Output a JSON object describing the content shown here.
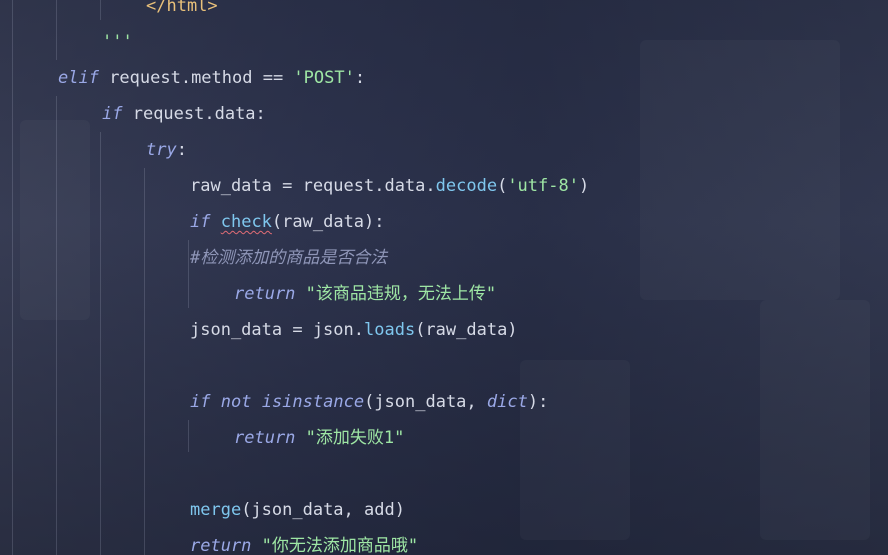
{
  "code_lines": [
    {
      "indent": 146,
      "tokens": [
        {
          "t": "</html>",
          "c": "tag"
        }
      ]
    },
    {
      "indent": 102,
      "tokens": [
        {
          "t": "'''",
          "c": "str"
        }
      ]
    },
    {
      "indent": 58,
      "tokens": [
        {
          "t": "elif",
          "c": "kw"
        },
        {
          "t": " request.method == ",
          "c": "plain"
        },
        {
          "t": "'POST'",
          "c": "str"
        },
        {
          "t": ":",
          "c": "plain"
        }
      ]
    },
    {
      "indent": 102,
      "tokens": [
        {
          "t": "if",
          "c": "kw"
        },
        {
          "t": " request.data:",
          "c": "plain"
        }
      ]
    },
    {
      "indent": 146,
      "tokens": [
        {
          "t": "try",
          "c": "kw"
        },
        {
          "t": ":",
          "c": "plain"
        }
      ]
    },
    {
      "indent": 190,
      "tokens": [
        {
          "t": "raw_data = request.data.",
          "c": "plain"
        },
        {
          "t": "decode",
          "c": "fn"
        },
        {
          "t": "(",
          "c": "plain"
        },
        {
          "t": "'utf-8'",
          "c": "str"
        },
        {
          "t": ")",
          "c": "plain"
        }
      ]
    },
    {
      "indent": 190,
      "tokens": [
        {
          "t": "if",
          "c": "kw"
        },
        {
          "t": " ",
          "c": "plain"
        },
        {
          "t": "check",
          "c": "fn squiggle"
        },
        {
          "t": "(raw_data):",
          "c": "plain"
        }
      ]
    },
    {
      "indent": 190,
      "tokens": [
        {
          "t": "#检测添加的商品是否合法",
          "c": "cm"
        }
      ]
    },
    {
      "indent": 234,
      "tokens": [
        {
          "t": "return",
          "c": "kw"
        },
        {
          "t": " ",
          "c": "plain"
        },
        {
          "t": "\"该商品违规，无法上传\"",
          "c": "str"
        }
      ]
    },
    {
      "indent": 190,
      "tokens": [
        {
          "t": "json_data = json.",
          "c": "plain"
        },
        {
          "t": "loads",
          "c": "fn"
        },
        {
          "t": "(raw_data)",
          "c": "plain"
        }
      ]
    },
    {
      "indent": 190,
      "tokens": []
    },
    {
      "indent": 190,
      "tokens": [
        {
          "t": "if",
          "c": "kw"
        },
        {
          "t": " ",
          "c": "plain"
        },
        {
          "t": "not",
          "c": "kw"
        },
        {
          "t": " ",
          "c": "plain"
        },
        {
          "t": "isinstance",
          "c": "kw"
        },
        {
          "t": "(json_data, ",
          "c": "plain"
        },
        {
          "t": "dict",
          "c": "kw"
        },
        {
          "t": "):",
          "c": "plain"
        }
      ]
    },
    {
      "indent": 234,
      "tokens": [
        {
          "t": "return",
          "c": "kw"
        },
        {
          "t": " ",
          "c": "plain"
        },
        {
          "t": "\"添加失败1\"",
          "c": "str"
        }
      ]
    },
    {
      "indent": 190,
      "tokens": []
    },
    {
      "indent": 190,
      "tokens": [
        {
          "t": "merge",
          "c": "fn"
        },
        {
          "t": "(json_data, add)",
          "c": "plain"
        }
      ]
    },
    {
      "indent": 190,
      "tokens": [
        {
          "t": "return",
          "c": "kw"
        },
        {
          "t": " ",
          "c": "plain"
        },
        {
          "t": "\"你无法添加商品哦\"",
          "c": "str"
        }
      ]
    }
  ],
  "colors": {
    "keyword": "#9aa8e6",
    "string": "#9ee6a4",
    "function": "#7fc7ee",
    "comment": "#8f96b8",
    "text": "#d6dae6",
    "error_underline": "#e06c75"
  }
}
